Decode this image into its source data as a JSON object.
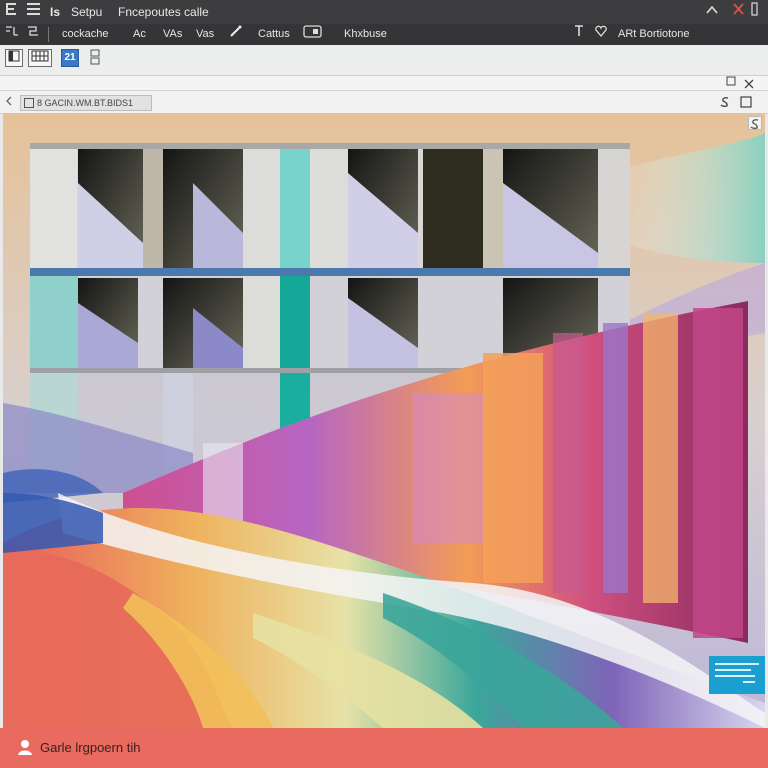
{
  "titlebar": {
    "icons": [
      "menu-icon",
      "list-icon"
    ],
    "app_name": "Is",
    "tab": "Setpu",
    "title": "Fncepoutes calle"
  },
  "toolbar": {
    "items": [
      "cockache",
      "Ac",
      "VAs",
      "Vas",
      "Cattus",
      "Khxbuse"
    ],
    "right_label": "ARt Bortiotone"
  },
  "iconbar": {
    "buttons": [
      "sidebar-icon",
      "grid-icon",
      "number-icon",
      "split-icon"
    ],
    "active_label": "21"
  },
  "address": {
    "text": "8 GACIN.WM.BT.BIDS1"
  },
  "statusbar": {
    "text": "Garle lrgpoern tih"
  },
  "colors": {
    "titlebar": "#3d3d3f",
    "toolbar": "#353537",
    "statusbar": "#e96a5e",
    "accent_teal": "#1aaea0",
    "accent_pink": "#c94b86"
  }
}
